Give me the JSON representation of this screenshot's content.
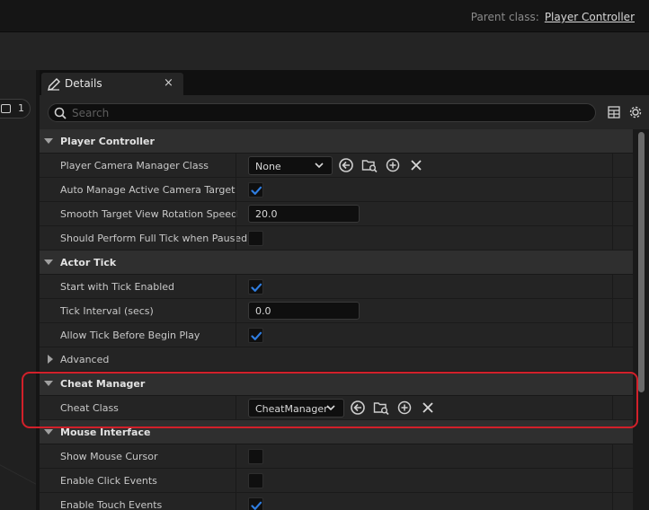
{
  "header": {
    "parent_class_label": "Parent class:",
    "parent_class_link": "Player Controller"
  },
  "viewport": {
    "camera_label": "1"
  },
  "details": {
    "tab_title": "Details",
    "tab_close": "×",
    "search_placeholder": "Search",
    "sections": {
      "player_controller": {
        "title": "Player Controller",
        "camera_manager_label": "Player Camera Manager Class",
        "camera_manager_value": "None",
        "auto_manage_label": "Auto Manage Active Camera Target",
        "auto_manage_checked": true,
        "smooth_label": "Smooth Target View Rotation Speed",
        "smooth_value": "20.0",
        "full_tick_label": "Should Perform Full Tick when Paused",
        "full_tick_checked": false
      },
      "actor_tick": {
        "title": "Actor Tick",
        "start_tick_label": "Start with Tick Enabled",
        "start_tick_checked": true,
        "interval_label": "Tick Interval (secs)",
        "interval_value": "0.0",
        "before_play_label": "Allow Tick Before Begin Play",
        "before_play_checked": true,
        "advanced_label": "Advanced"
      },
      "cheat_manager": {
        "title": "Cheat Manager",
        "cheat_class_label": "Cheat Class",
        "cheat_class_value": "CheatManager"
      },
      "mouse_interface": {
        "title": "Mouse Interface",
        "show_cursor_label": "Show Mouse Cursor",
        "show_cursor_checked": false,
        "click_events_label": "Enable Click Events",
        "click_events_checked": false,
        "touch_events_label": "Enable Touch Events",
        "touch_events_checked": true
      }
    }
  },
  "colors": {
    "accent": "#2f7de0",
    "highlight": "#d2202a"
  }
}
